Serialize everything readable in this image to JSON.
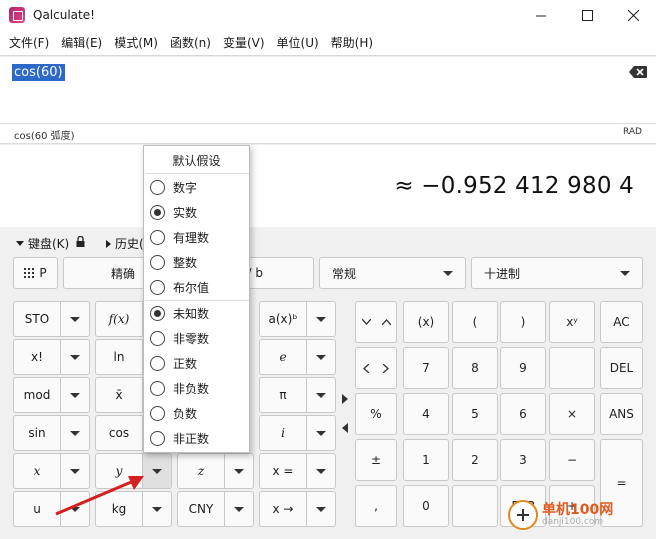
{
  "window": {
    "title": "Qalculate!"
  },
  "menu": [
    "文件(F)",
    "编辑(E)",
    "模式(M)",
    "函数(n)",
    "变量(V)",
    "单位(U)",
    "帮助(H)"
  ],
  "expression": {
    "value": "cos(60)"
  },
  "status": {
    "parsed": "cos(60 弧度)",
    "angle_mode": "RAD"
  },
  "result": {
    "value": "≈ −0.952 412 980 4"
  },
  "keypad_bar": {
    "keyboard_label": "键盘(K)",
    "history_label": "历史("
  },
  "top_row": {
    "grid_label": "P",
    "precision_label": "精确",
    "fraction_label": "/ b",
    "mode_combo": "常规",
    "base_combo": "十进制"
  },
  "func_buttons": [
    [
      "STO",
      "f(x)",
      "a(x)ᵇ"
    ],
    [
      "x!",
      "ln",
      "e"
    ],
    [
      "mod",
      "x̄",
      "π"
    ],
    [
      "sin",
      "cos",
      "i"
    ],
    [
      "x",
      "y",
      "z",
      "x ="
    ],
    [
      "u",
      "kg",
      "CNY",
      "x →"
    ]
  ],
  "numpad": {
    "row1": [
      "(x)",
      "(",
      ")",
      "xʸ",
      "AC"
    ],
    "row2": [
      "7",
      "8",
      "9",
      "DEL"
    ],
    "row3": [
      "%",
      "4",
      "5",
      "6",
      "×",
      "ANS"
    ],
    "row4": [
      "±",
      "1",
      "2",
      "3",
      "−",
      "="
    ],
    "row5": [
      ",",
      "0",
      "EXP",
      "+"
    ]
  },
  "popup": {
    "header": "默认假设",
    "group1": [
      {
        "label": "数字",
        "checked": false
      },
      {
        "label": "实数",
        "checked": true
      },
      {
        "label": "有理数",
        "checked": false
      },
      {
        "label": "整数",
        "checked": false
      },
      {
        "label": "布尔值",
        "checked": false
      }
    ],
    "group2": [
      {
        "label": "未知数",
        "checked": true
      },
      {
        "label": "非零数",
        "checked": false
      },
      {
        "label": "正数",
        "checked": false
      },
      {
        "label": "非负数",
        "checked": false
      },
      {
        "label": "负数",
        "checked": false
      },
      {
        "label": "非正数",
        "checked": false
      }
    ]
  },
  "watermark": {
    "text": "单机100网",
    "sub": "danji100.com"
  }
}
